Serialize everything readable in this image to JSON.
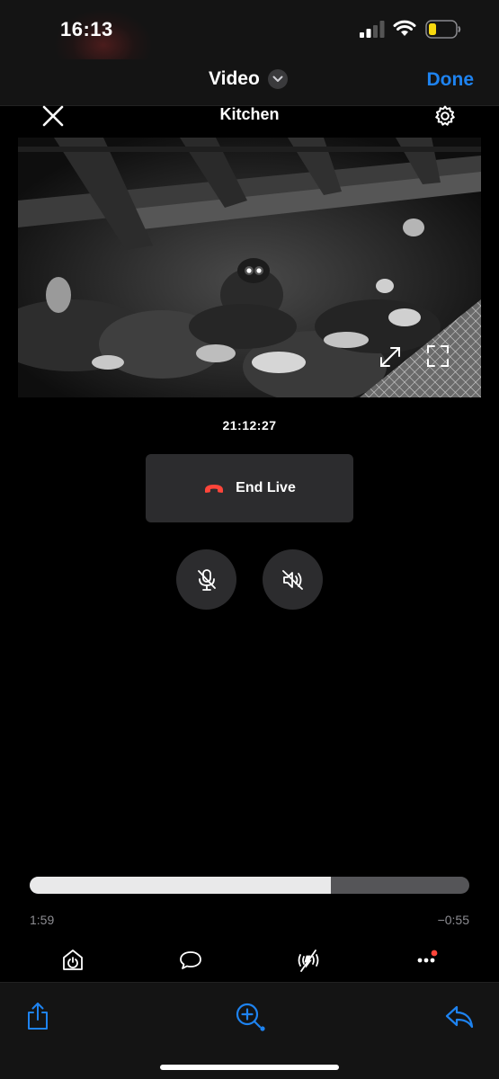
{
  "status_bar": {
    "time": "16:13",
    "icons": [
      "cellular-signal-icon",
      "wifi-icon",
      "battery-low-icon"
    ],
    "battery_color": "#f8d90f"
  },
  "nav": {
    "title": "Video",
    "done_label": "Done",
    "accent_color": "#1e83f0"
  },
  "camera": {
    "name": "Kitchen",
    "timestamp": "21:12:27",
    "end_live_label": "End Live",
    "end_live_icon_color": "#ff453a",
    "controls": [
      "mic-muted-icon",
      "speaker-muted-icon"
    ]
  },
  "playback": {
    "elapsed": "1:59",
    "remaining": "−0:55",
    "progress_fraction": 0.685
  },
  "app_tools": [
    "home-icon",
    "chat-bubble-icon",
    "motion-off-icon",
    "more-options-icon"
  ],
  "toolbar": [
    "share-icon",
    "zoom-add-icon",
    "reply-icon"
  ]
}
